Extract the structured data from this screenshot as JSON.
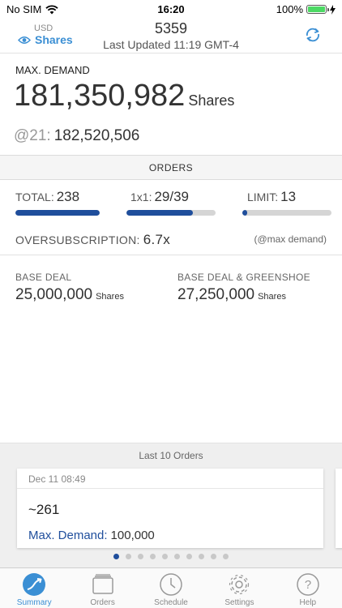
{
  "status_bar": {
    "carrier": "No SIM",
    "time": "16:20",
    "battery": "100%",
    "battery_level": 1.0
  },
  "header": {
    "currency": "USD",
    "unit_toggle": "Shares",
    "title": "5359",
    "last_updated": "Last Updated 11:19 GMT-4",
    "icons": {
      "unit": "eye-icon",
      "refresh": "refresh-icon"
    },
    "accent_color": "#3b8fd4"
  },
  "demand": {
    "label": "MAX. DEMAND",
    "value": "181,350,982",
    "unit": "Shares",
    "at_price_label": "@21:",
    "at_price_value": "182,520,506"
  },
  "orders": {
    "section_title": "ORDERS",
    "total_label": "TOTAL:",
    "total_value": "238",
    "total_fill": 1.0,
    "one_on_one_label": "1x1:",
    "one_on_one_value": "29/39",
    "one_on_one_fill": 0.744,
    "limit_label": "LIMIT:",
    "limit_value": "13",
    "limit_fill": 0.055,
    "bar_color": "#1f4e9c",
    "oversubscription_label": "OVERSUBSCRIPTION:",
    "oversubscription_value": "6.7x",
    "oversubscription_note": "(@max demand)"
  },
  "deal": {
    "base_label": "BASE DEAL",
    "base_value": "25,000,000",
    "base_unit": "Shares",
    "greenshoe_label": "BASE DEAL & GREENSHOE",
    "greenshoe_value": "27,250,000",
    "greenshoe_unit": "Shares"
  },
  "last_orders": {
    "title": "Last 10 Orders",
    "card": {
      "date": "Dec 11 08:49",
      "amount": "~261",
      "demand_label": "Max. Demand:",
      "demand_value": "100,000"
    },
    "page_count": 10,
    "active_page": 1
  },
  "tab_bar": {
    "items": [
      {
        "label": "Summary",
        "icon": "chart-icon",
        "active": true
      },
      {
        "label": "Orders",
        "icon": "folder-icon",
        "active": false
      },
      {
        "label": "Schedule",
        "icon": "clock-icon",
        "active": false
      },
      {
        "label": "Settings",
        "icon": "gear-icon",
        "active": false
      },
      {
        "label": "Help",
        "icon": "help-icon",
        "active": false
      }
    ]
  }
}
